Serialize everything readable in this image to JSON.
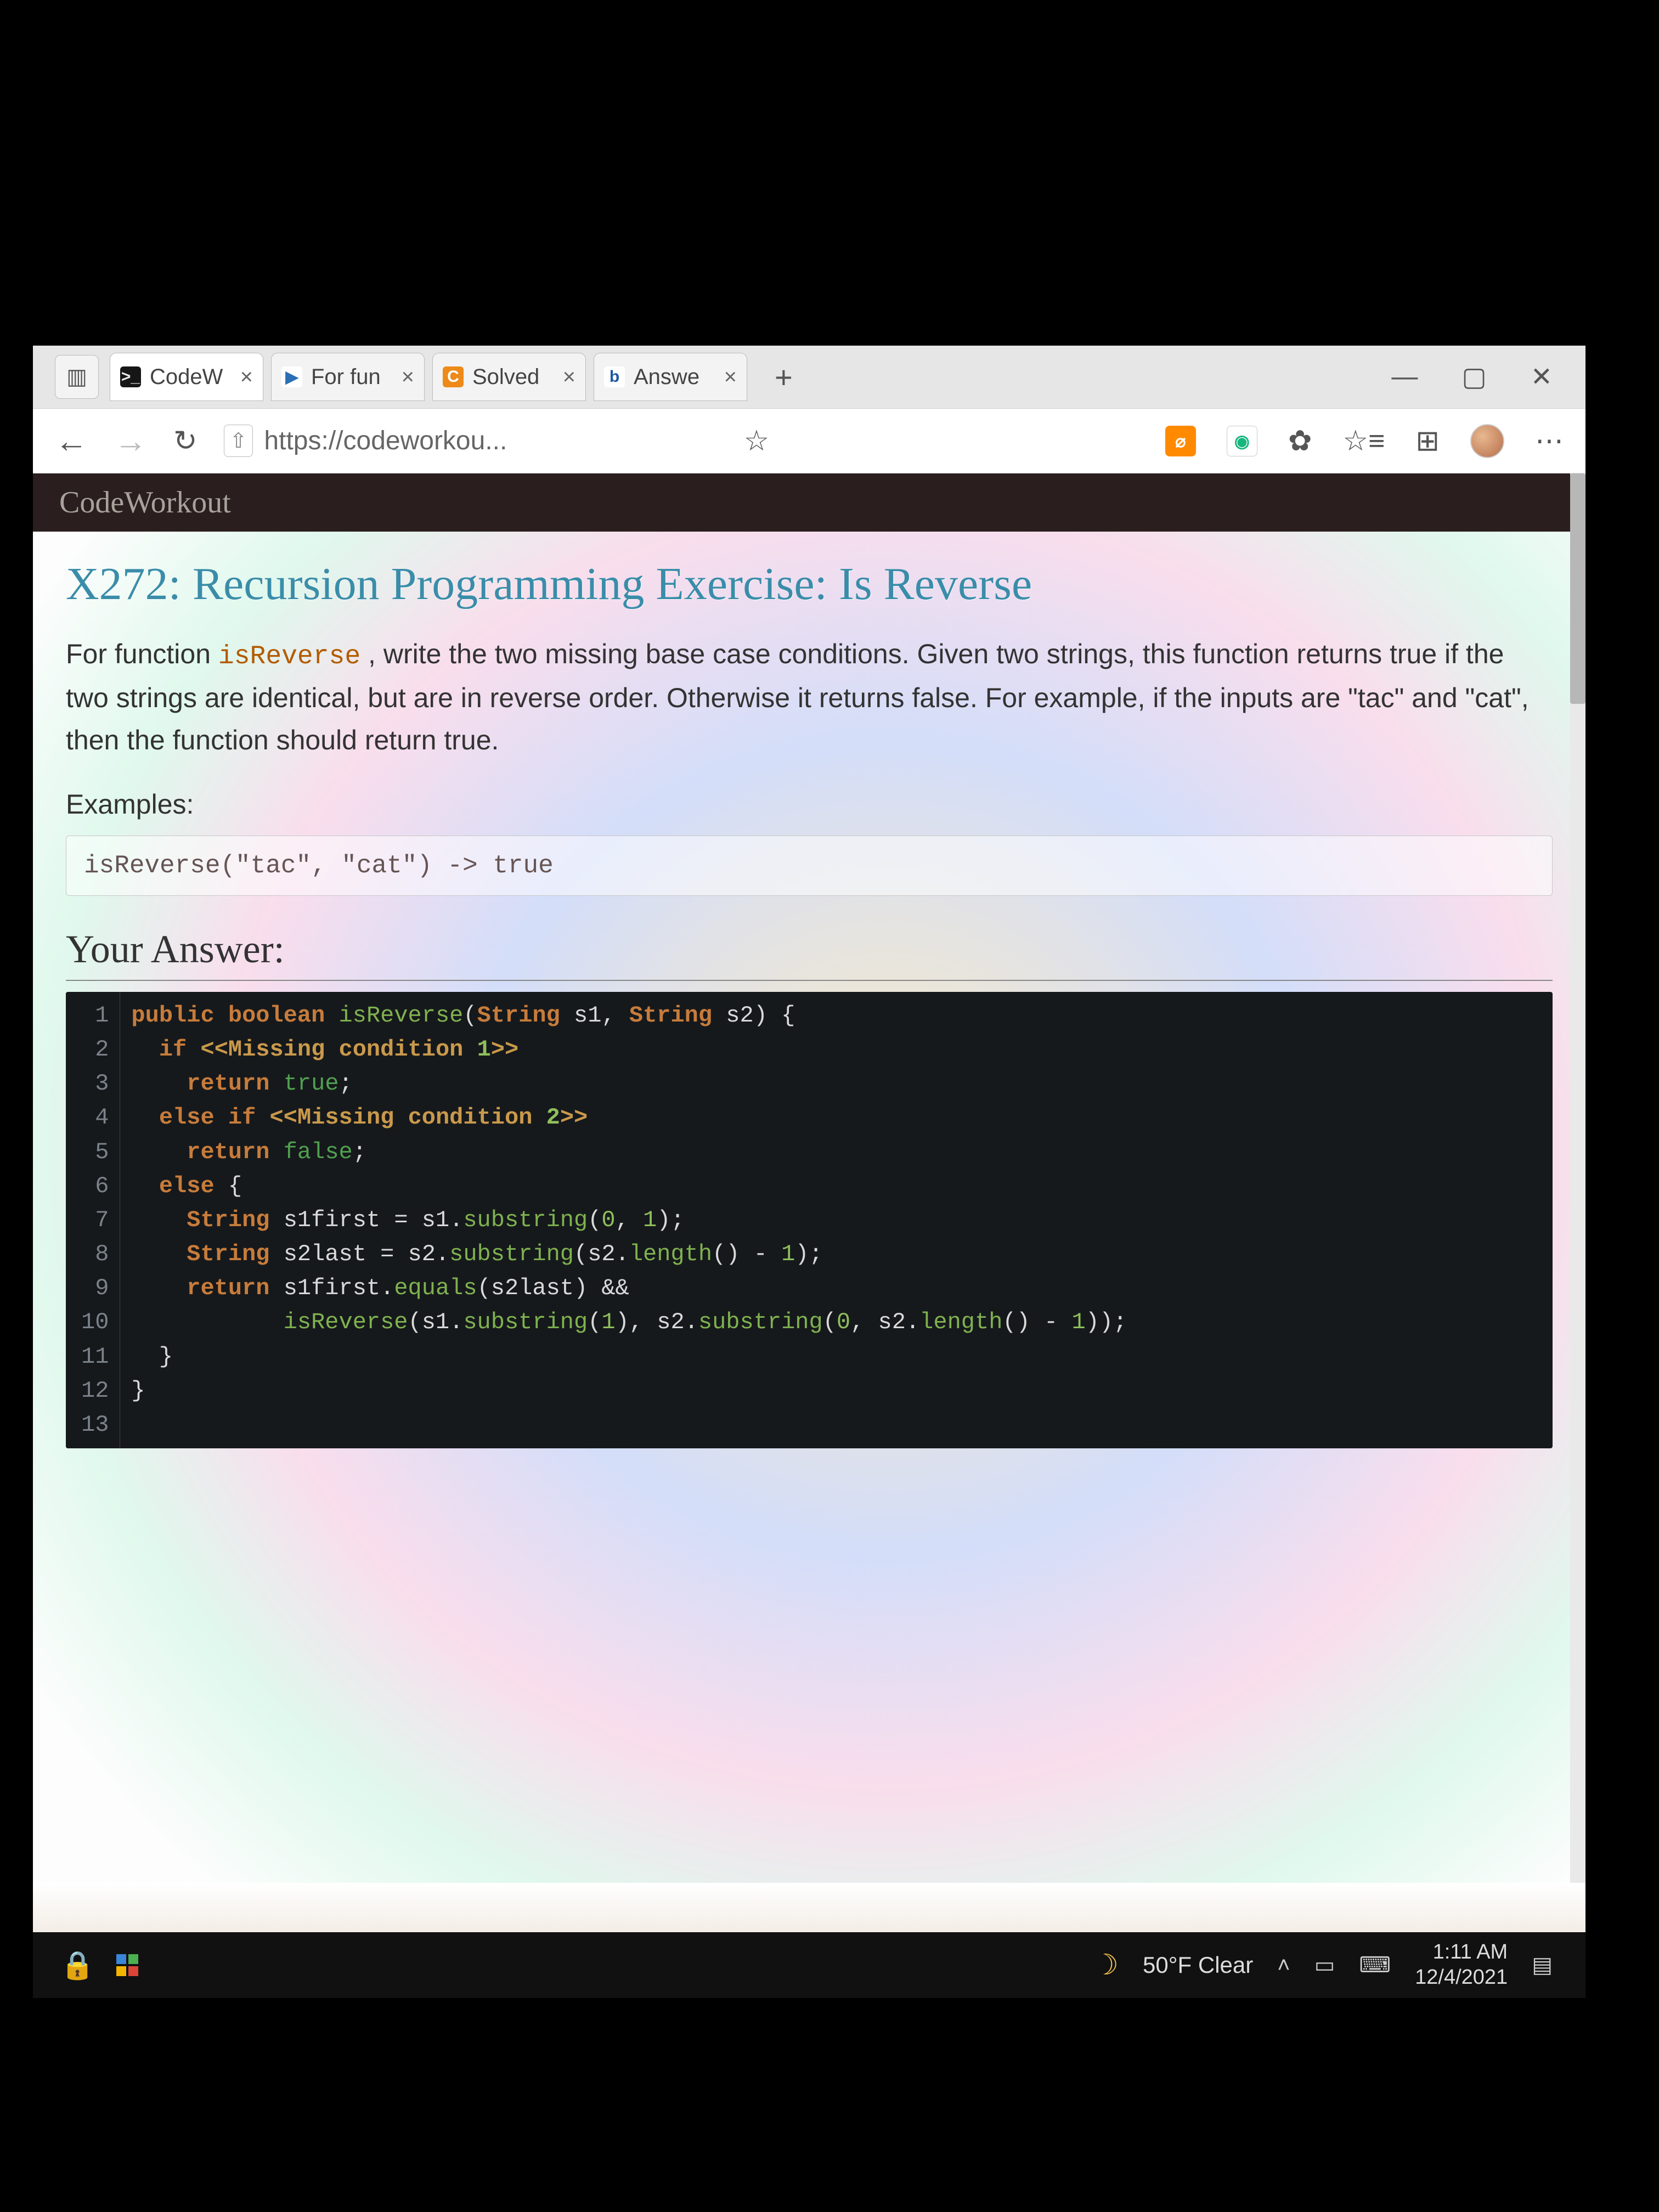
{
  "tabs": [
    {
      "label": "CodeW",
      "icon_bg": "#161616",
      "icon_fg": "#e8e8e8",
      "icon_text": ">_",
      "active": true
    },
    {
      "label": "For fun",
      "icon_bg": "#ffffff",
      "icon_fg": "#2a6fb5",
      "icon_text": "▶",
      "active": false
    },
    {
      "label": "Solved",
      "icon_bg": "#ed8a19",
      "icon_fg": "#ffffff",
      "icon_text": "C",
      "active": false
    },
    {
      "label": "Answe",
      "icon_bg": "#ffffff",
      "icon_fg": "#1e5aa3",
      "icon_text": "b",
      "active": false
    }
  ],
  "window_controls": {
    "min": "—",
    "max": "▢",
    "close": "✕"
  },
  "address": {
    "url": "https://codeworkou..."
  },
  "brand": "CodeWorkout",
  "page": {
    "title": "X272: Recursion Programming Exercise: Is Reverse",
    "description_html": "For function <code>isReverse</code> , write the two missing base case conditions. Given two strings, this function returns true if the two strings are identical, but are in reverse order. Otherwise it returns false. For example, if the inputs are \"tac\" and \"cat\", then the function should return true.",
    "examples_label": "Examples:",
    "example_text": "isReverse(\"tac\", \"cat\") -> true",
    "answer_label": "Your Answer:"
  },
  "code_lines": [
    "public boolean isReverse(String s1, String s2) {",
    "  if <<Missing condition 1>>",
    "    return true;",
    "  else if <<Missing condition 2>>",
    "    return false;",
    "  else {",
    "    String s1first = s1.substring(0, 1);",
    "    String s2last = s2.substring(s2.length() - 1);",
    "    return s1first.equals(s2last) &&",
    "           isReverse(s1.substring(1), s2.substring(0, s2.length() - 1));",
    "  }",
    "}",
    ""
  ],
  "taskbar": {
    "weather": "50°F Clear",
    "time": "1:11 AM",
    "date": "12/4/2021"
  }
}
